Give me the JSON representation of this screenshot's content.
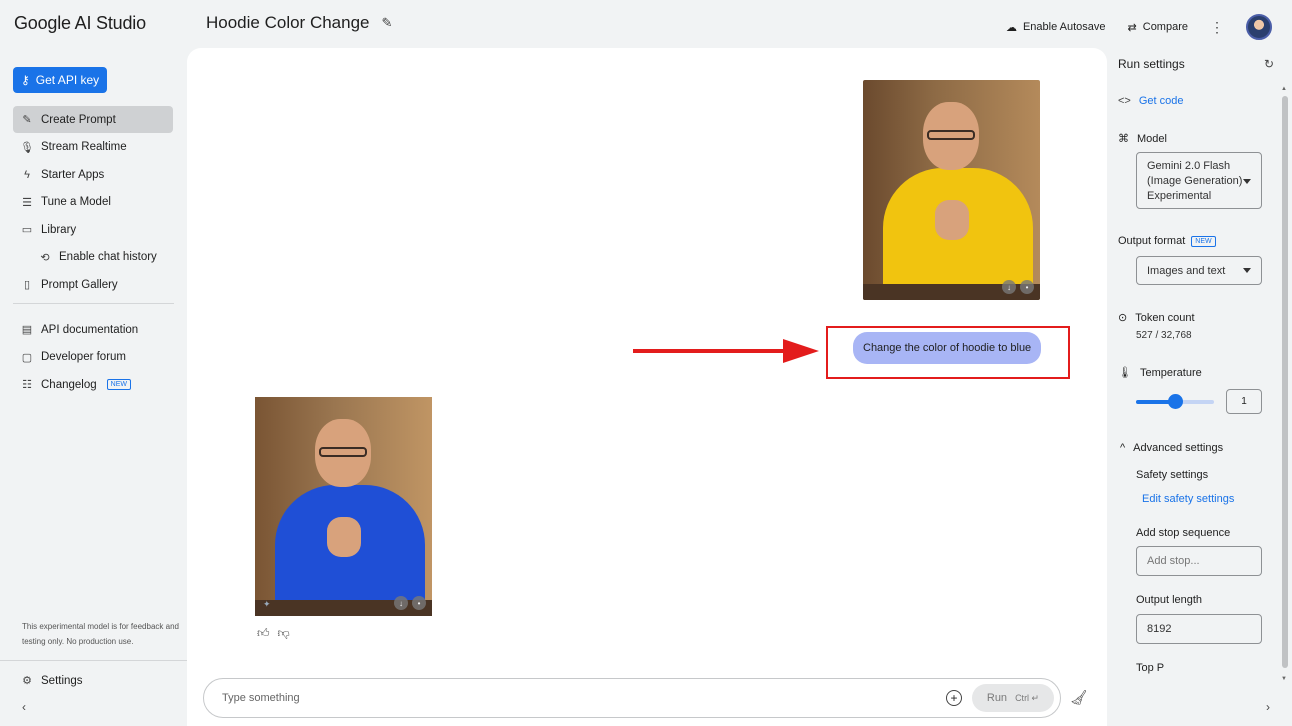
{
  "app": {
    "brand": "Google AI Studio"
  },
  "sidebar": {
    "api_key_label": "Get API key",
    "items": [
      {
        "label": "Create Prompt"
      },
      {
        "label": "Stream Realtime"
      },
      {
        "label": "Starter Apps"
      },
      {
        "label": "Tune a Model"
      },
      {
        "label": "Library"
      },
      {
        "label": "Enable chat history"
      },
      {
        "label": "Prompt Gallery"
      }
    ],
    "items2": [
      {
        "label": "API documentation"
      },
      {
        "label": "Developer forum"
      },
      {
        "label": "Changelog",
        "badge": "NEW"
      }
    ],
    "disclaimer": "This experimental model is for feedback and testing only. No production use.",
    "settings_label": "Settings"
  },
  "header": {
    "title": "Hoodie Color Change",
    "autosave_label": "Enable Autosave",
    "compare_label": "Compare"
  },
  "chat": {
    "user_message": "Change the color of hoodie to blue",
    "input_placeholder": "Type something",
    "run_label": "Run",
    "run_shortcut": "Ctrl ↵"
  },
  "run_settings": {
    "title": "Run settings",
    "get_code": "Get code",
    "model_label": "Model",
    "model_value": [
      "Gemini 2.0 Flash",
      "(Image Generation)",
      "Experimental"
    ],
    "output_format_label": "Output format",
    "output_format_badge": "NEW",
    "output_format_value": "Images and text",
    "token_count_label": "Token count",
    "token_count_value": "527 / 32,768",
    "temperature_label": "Temperature",
    "temperature_value": "1",
    "temperature_fraction": 0.5,
    "advanced_label": "Advanced settings",
    "safety_label": "Safety settings",
    "edit_safety": "Edit safety settings",
    "stop_seq_label": "Add stop sequence",
    "stop_seq_placeholder": "Add stop...",
    "output_length_label": "Output length",
    "output_length_value": "8192",
    "top_p_label": "Top P"
  },
  "colors": {
    "accent": "#1a73e8",
    "bubble": "#a8b5f5",
    "highlight": "#e31c1c"
  }
}
